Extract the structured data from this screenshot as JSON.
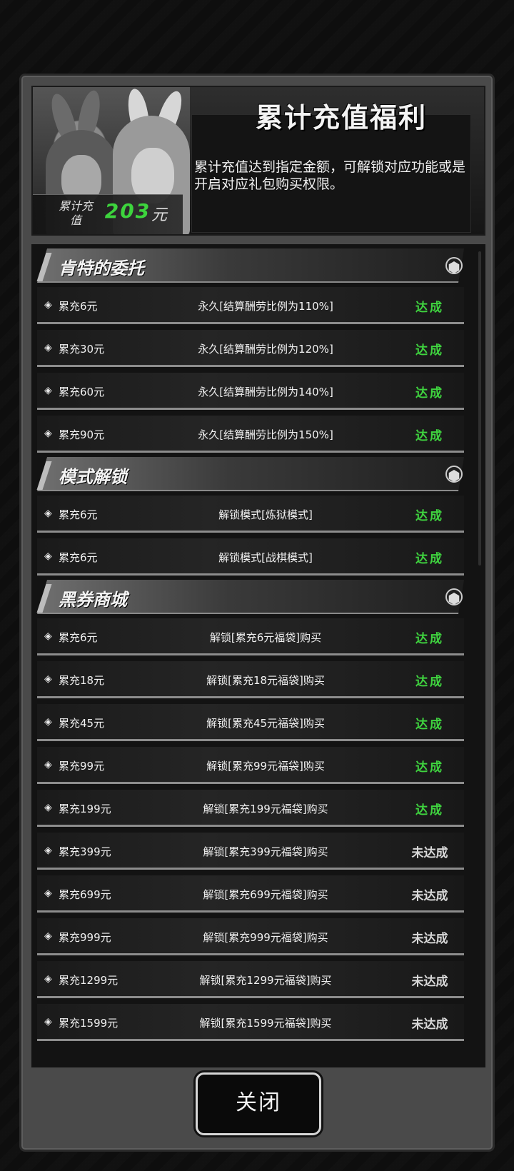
{
  "title": "累计充值福利",
  "description": "累计充值达到指定金额，可解锁对应功能或是开启对应礼包购买权限。",
  "total": {
    "label": "累计充值",
    "value": "203",
    "unit": "元"
  },
  "sections": [
    {
      "title": "肯特的委托",
      "rows": [
        {
          "req": "累充6元",
          "reward": "永久[结算酬劳比例为110%]",
          "status": "达成"
        },
        {
          "req": "累充30元",
          "reward": "永久[结算酬劳比例为120%]",
          "status": "达成"
        },
        {
          "req": "累充60元",
          "reward": "永久[结算酬劳比例为140%]",
          "status": "达成"
        },
        {
          "req": "累充90元",
          "reward": "永久[结算酬劳比例为150%]",
          "status": "达成"
        }
      ]
    },
    {
      "title": "模式解锁",
      "rows": [
        {
          "req": "累充6元",
          "reward": "解锁模式[炼狱模式]",
          "status": "达成"
        },
        {
          "req": "累充6元",
          "reward": "解锁模式[战棋模式]",
          "status": "达成"
        }
      ]
    },
    {
      "title": "黑券商城",
      "rows": [
        {
          "req": "累充6元",
          "reward": "解锁[累充6元福袋]购买",
          "status": "达成"
        },
        {
          "req": "累充18元",
          "reward": "解锁[累充18元福袋]购买",
          "status": "达成"
        },
        {
          "req": "累充45元",
          "reward": "解锁[累充45元福袋]购买",
          "status": "达成"
        },
        {
          "req": "累充99元",
          "reward": "解锁[累充99元福袋]购买",
          "status": "达成"
        },
        {
          "req": "累充199元",
          "reward": "解锁[累充199元福袋]购买",
          "status": "达成"
        },
        {
          "req": "累充399元",
          "reward": "解锁[累充399元福袋]购买",
          "status": "未达成"
        },
        {
          "req": "累充699元",
          "reward": "解锁[累充699元福袋]购买",
          "status": "未达成"
        },
        {
          "req": "累充999元",
          "reward": "解锁[累充999元福袋]购买",
          "status": "未达成"
        },
        {
          "req": "累充1299元",
          "reward": "解锁[累充1299元福袋]购买",
          "status": "未达成"
        },
        {
          "req": "累充1599元",
          "reward": "解锁[累充1599元福袋]购买",
          "status": "未达成"
        }
      ]
    }
  ],
  "close_label": "关闭",
  "colors": {
    "done": "#3fd43f",
    "todo": "#d9d9d9",
    "accent_total": "#3dd43d"
  },
  "icons": {
    "row_icon": "stack-layers-icon",
    "section_icon": "hexagon-icon"
  }
}
